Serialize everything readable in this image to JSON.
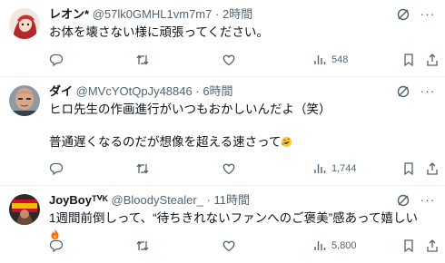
{
  "replies": [
    {
      "name": "レオン*",
      "handle": "@57lk0GMHL1vm7m7",
      "separator": "·",
      "time": "2時間",
      "text": "お体を壊さない様に頑張ってください。",
      "views": "548"
    },
    {
      "name": "ダイ",
      "handle": "@MVcYOtQpJy48846",
      "separator": "·",
      "time": "6時間",
      "text": "ヒロ先生の作画進行がいつもおかしいんだよ（笑）\n\n普通遅くなるのだが想像を超える速さって",
      "views": "1,744"
    },
    {
      "name": "JoyBoyᵀⱽᴷ",
      "handle": "@BloodyStealer_",
      "separator": "·",
      "time": "11時間",
      "text": "1週間前倒しって、“待ちきれないファンへのご褒美”感あって嬉しい",
      "views": "5,800"
    }
  ],
  "icons": {
    "reply": "reply-icon",
    "repost": "repost-icon",
    "like": "like-icon",
    "views": "views-icon",
    "bookmark": "bookmark-icon",
    "share": "share-icon",
    "grok": "grok-icon",
    "more": "more-icon"
  },
  "colors": {
    "text": "#0f1419",
    "muted": "#536471",
    "divider": "#eff3f4"
  }
}
